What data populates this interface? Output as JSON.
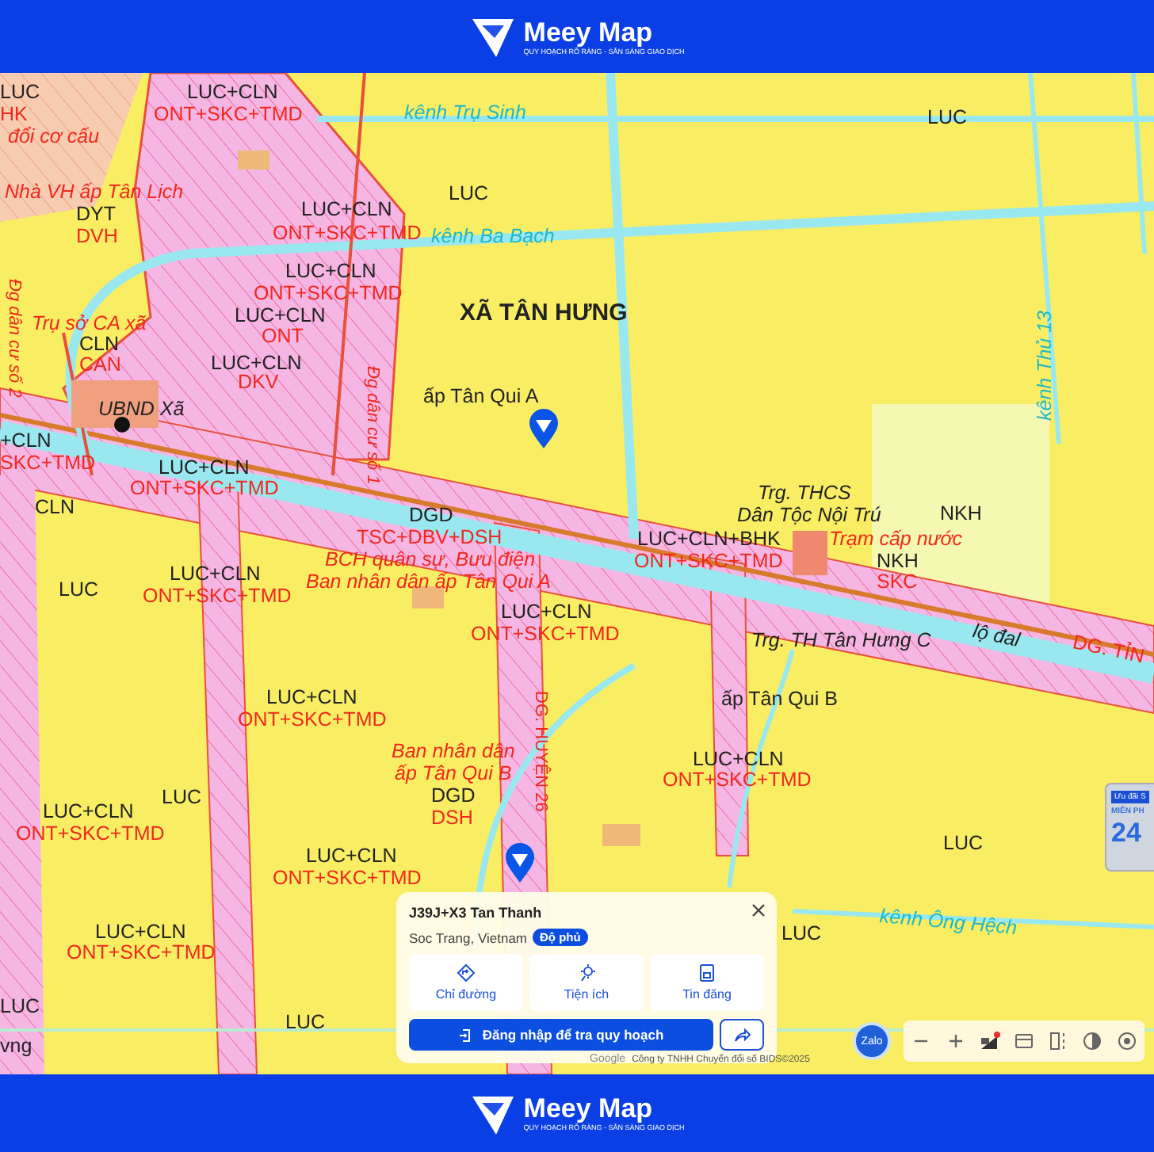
{
  "header": {
    "logo_text": "Meey Map",
    "tagline": "QUY HOẠCH RÕ RÀNG - SẴN SÀNG GIAO DỊCH"
  },
  "map": {
    "labels": [
      {
        "text": "LUC",
        "kind": "code"
      },
      {
        "text": "HK",
        "kind": "code-red"
      },
      {
        "text": "đổi cơ cấu",
        "kind": "place-red"
      },
      {
        "text": "LUC+CLN",
        "kind": "code"
      },
      {
        "text": "ONT+SKC+TMD",
        "kind": "code-red"
      },
      {
        "text": "kênh Trụ Sinh",
        "kind": "canal"
      },
      {
        "text": "LUC",
        "kind": "code"
      },
      {
        "text": "Nhà VH ấp Tân Lịch",
        "kind": "place-red"
      },
      {
        "text": "LUC",
        "kind": "code"
      },
      {
        "text": "DYT",
        "kind": "code"
      },
      {
        "text": "DVH",
        "kind": "code-red"
      },
      {
        "text": "LUC+CLN",
        "kind": "code"
      },
      {
        "text": "ONT+SKC+TMD",
        "kind": "code-red"
      },
      {
        "text": "kênh Ba Bạch",
        "kind": "canal"
      },
      {
        "text": "LUC+CLN",
        "kind": "code"
      },
      {
        "text": "ONT+SKC+TMD",
        "kind": "code-red"
      },
      {
        "text": "XÃ TÂN HƯNG",
        "kind": "commune"
      },
      {
        "text": "Trụ sở CA xã",
        "kind": "place-red"
      },
      {
        "text": "LUC+CLN",
        "kind": "code"
      },
      {
        "text": "ONT",
        "kind": "code-red"
      },
      {
        "text": "CLN",
        "kind": "code"
      },
      {
        "text": "CAN",
        "kind": "code-red"
      },
      {
        "text": "LUC+CLN",
        "kind": "code"
      },
      {
        "text": "DKV",
        "kind": "code-red"
      },
      {
        "text": "ấp Tân Qui A",
        "kind": "place"
      },
      {
        "text": "UBND Xã",
        "kind": "place-italic"
      },
      {
        "text": "+CLN",
        "kind": "code"
      },
      {
        "text": "SKC+TMD",
        "kind": "code-red"
      },
      {
        "text": "LUC+CLN",
        "kind": "code"
      },
      {
        "text": "ONT+SKC+TMD",
        "kind": "code-red"
      },
      {
        "text": "CLN",
        "kind": "code"
      },
      {
        "text": "DGD",
        "kind": "code"
      },
      {
        "text": "TSC+DBV+DSH",
        "kind": "code-red"
      },
      {
        "text": "BCH quân sự, Bưu điện",
        "kind": "place-red"
      },
      {
        "text": "Ban nhân dân ấp Tân Qui A",
        "kind": "place-red"
      },
      {
        "text": "Trg. THCS",
        "kind": "place-italic"
      },
      {
        "text": "Dân Tộc Nội Trú",
        "kind": "place-italic"
      },
      {
        "text": "NKH",
        "kind": "code"
      },
      {
        "text": "LUC+CLN+BHK",
        "kind": "code"
      },
      {
        "text": "ONT+SKC+TMD",
        "kind": "code-red"
      },
      {
        "text": "Trạm cấp nước",
        "kind": "place-red"
      },
      {
        "text": "NKH",
        "kind": "code"
      },
      {
        "text": "SKC",
        "kind": "code-red"
      },
      {
        "text": "LUC",
        "kind": "code"
      },
      {
        "text": "LUC+CLN",
        "kind": "code"
      },
      {
        "text": "ONT+SKC+TMD",
        "kind": "code-red"
      },
      {
        "text": "LUC+CLN",
        "kind": "code"
      },
      {
        "text": "ONT+SKC+TMD",
        "kind": "code-red"
      },
      {
        "text": "Trg. TH Tân Hưng C",
        "kind": "place-italic"
      },
      {
        "text": "lộ đal",
        "kind": "place-italic"
      },
      {
        "text": "DG. TỈN",
        "kind": "code-red"
      },
      {
        "text": "LUC+CLN",
        "kind": "code"
      },
      {
        "text": "ấp Tân Qui B",
        "kind": "place"
      },
      {
        "text": "ONT+SKC+TMD",
        "kind": "code-red"
      },
      {
        "text": "DG. HUYỆN 26",
        "kind": "code-red"
      },
      {
        "text": "Ban nhân dân",
        "kind": "place-red"
      },
      {
        "text": "ấp Tân Qui B",
        "kind": "place-red"
      },
      {
        "text": "LUC",
        "kind": "code"
      },
      {
        "text": "LUC+CLN",
        "kind": "code"
      },
      {
        "text": "ONT+SKC+TMD",
        "kind": "code-red"
      },
      {
        "text": "LUC+CLN",
        "kind": "code"
      },
      {
        "text": "ONT+SKC+TMD",
        "kind": "code-red"
      },
      {
        "text": "DGD",
        "kind": "code"
      },
      {
        "text": "DSH",
        "kind": "code-red"
      },
      {
        "text": "LUC",
        "kind": "code"
      },
      {
        "text": "LUC+CLN",
        "kind": "code"
      },
      {
        "text": "ONT+SKC+TMD",
        "kind": "code-red"
      },
      {
        "text": "LUC",
        "kind": "code"
      },
      {
        "text": "kênh Ông Hệch",
        "kind": "canal"
      },
      {
        "text": "LUC+CLN",
        "kind": "code"
      },
      {
        "text": "ONT+SKC+TMD",
        "kind": "code-red"
      },
      {
        "text": "LUC",
        "kind": "code"
      },
      {
        "text": "LUC",
        "kind": "code"
      },
      {
        "text": "vng",
        "kind": "code"
      },
      {
        "text": "Đg dân cư số 2",
        "kind": "place-red"
      },
      {
        "text": "Đg dân cư số 1",
        "kind": "place-red"
      },
      {
        "text": "kênh Thủ 13",
        "kind": "canal"
      }
    ],
    "promo": {
      "tag": "Ưu đãi S",
      "headline": "MIỄN PH",
      "number": "24"
    }
  },
  "place_card": {
    "title": "J39J+X3 Tan Thanh",
    "subtitle": "Soc Trang, Vietnam",
    "badge": "Độ phủ",
    "actions": [
      {
        "label": "Chỉ đường",
        "kind": "directions"
      },
      {
        "label": "Tiện ích",
        "kind": "amenities"
      },
      {
        "label": "Tin đăng",
        "kind": "listings"
      }
    ],
    "login_button": "Đăng nhập để tra quy hoạch"
  },
  "attribution": {
    "provider": "Google",
    "copyright": "Công ty TNHH Chuyển đổi số BIDS©2025"
  },
  "chat_button": "Zalo",
  "footer": {
    "logo_text": "Meey Map",
    "tagline": "QUY HOẠCH RÕ RÀNG - SẴN SÀNG GIAO DỊCH"
  }
}
